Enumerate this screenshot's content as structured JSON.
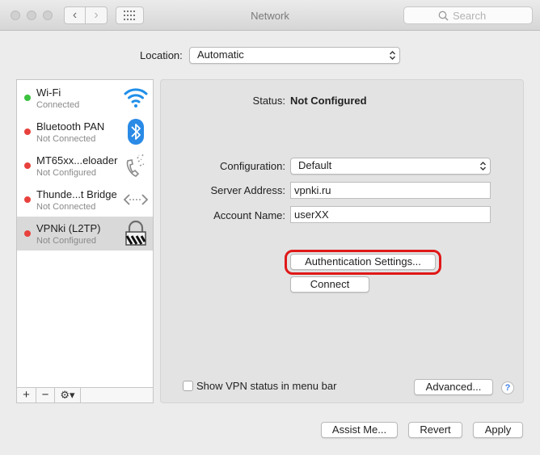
{
  "window": {
    "title": "Network"
  },
  "toolbar": {
    "back_label": "‹",
    "forward_label": "›",
    "search_placeholder": "Search"
  },
  "location": {
    "label": "Location:",
    "value": "Automatic"
  },
  "services": [
    {
      "name": "Wi-Fi",
      "status": "Connected",
      "status_color": "#3cc23f",
      "icon": "wifi-icon"
    },
    {
      "name": "Bluetooth PAN",
      "status": "Not Connected",
      "status_color": "#e8413d",
      "icon": "bluetooth-icon"
    },
    {
      "name": "MT65xx...eloader",
      "status": "Not Configured",
      "status_color": "#e8413d",
      "icon": "phone-icon"
    },
    {
      "name": "Thunde...t Bridge",
      "status": "Not Connected",
      "status_color": "#e8413d",
      "icon": "thunderbolt-bridge-icon"
    },
    {
      "name": "VPNki (L2TP)",
      "status": "Not Configured",
      "status_color": "#e8413d",
      "icon": "vpn-lock-icon",
      "selected": true
    }
  ],
  "sidebar_tools": {
    "add": "+",
    "remove": "−",
    "gear": "⚙▾"
  },
  "detail": {
    "status_label": "Status:",
    "status_value": "Not Configured",
    "configuration_label": "Configuration:",
    "configuration_value": "Default",
    "server_label": "Server Address:",
    "server_value": "vpnki.ru",
    "account_label": "Account Name:",
    "account_value": "userXX",
    "auth_button": "Authentication Settings...",
    "connect_button": "Connect",
    "show_vpn_label": "Show VPN status in menu bar",
    "show_vpn_checked": false,
    "advanced_button": "Advanced...",
    "help_button": "?"
  },
  "footer": {
    "assist_button": "Assist Me...",
    "revert_button": "Revert",
    "apply_button": "Apply"
  },
  "colors": {
    "highlight": "#e01818",
    "selected_row": "#d9d9d9"
  }
}
